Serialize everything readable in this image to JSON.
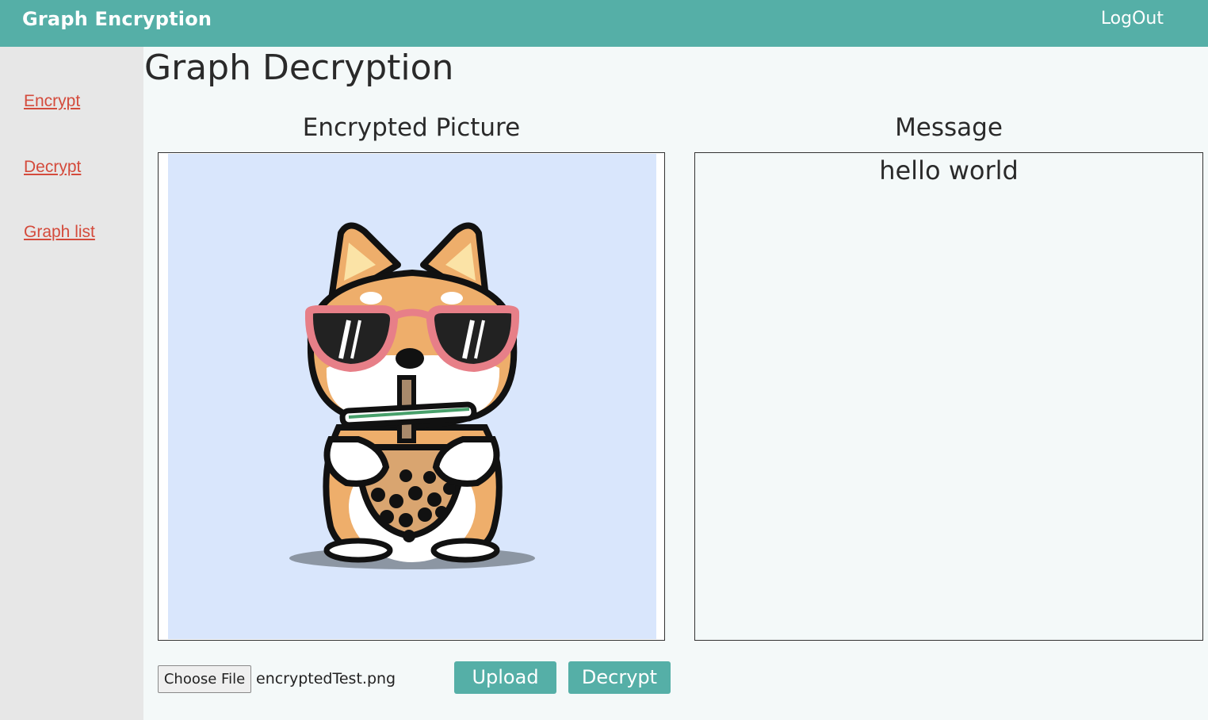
{
  "header": {
    "brand": "Graph Encryption",
    "logout_label": "LogOut",
    "bar_color": "#55afa7"
  },
  "sidebar": {
    "items": [
      {
        "label": "Encrypt"
      },
      {
        "label": "Decrypt"
      },
      {
        "label": "Graph list"
      }
    ],
    "link_color": "#d44b3c"
  },
  "main": {
    "title": "Graph Decryption",
    "picture_heading": "Encrypted Picture",
    "message_heading": "Message",
    "message_text": "hello world",
    "picture_icon": "shiba-dog-sunglasses-boba-tea-illustration"
  },
  "controls": {
    "choose_file_label": "Choose File",
    "file_name": "encryptedTest.png",
    "upload_label": "Upload",
    "decrypt_label": "Decrypt"
  }
}
